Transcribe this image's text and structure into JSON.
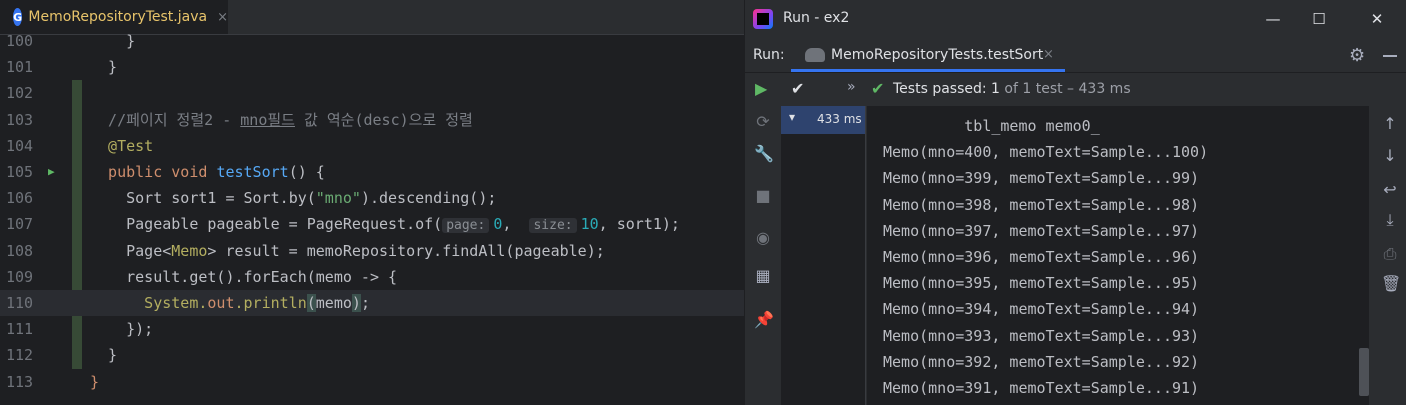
{
  "editor": {
    "tab": {
      "icon_letter": "G",
      "filename": "MemoRepositoryTest.java",
      "close": "×"
    },
    "lines": [
      {
        "num": "100",
        "code": [
          {
            "c": "ty",
            "t": "    }"
          }
        ]
      },
      {
        "num": "101",
        "code": [
          {
            "c": "ty",
            "t": "  }"
          }
        ]
      },
      {
        "num": "102",
        "code": []
      },
      {
        "num": "103",
        "code": [
          {
            "c": "cm",
            "t": "  //페이지 정렬2 - "
          },
          {
            "c": "cm u",
            "t": "mno필드"
          },
          {
            "c": "cm",
            "t": " 값 역순(desc)으로 정렬"
          }
        ]
      },
      {
        "num": "104",
        "code": [
          {
            "c": "an",
            "t": "  @Test"
          }
        ]
      },
      {
        "num": "105",
        "code": [
          {
            "c": "kw",
            "t": "  public void "
          },
          {
            "c": "fn",
            "t": "testSort"
          },
          {
            "c": "ty",
            "t": "() {"
          }
        ]
      },
      {
        "num": "106",
        "code": [
          {
            "c": "ty",
            "t": "    Sort sort1 = Sort."
          },
          {
            "c": "ty",
            "t": "by("
          },
          {
            "c": "st",
            "t": "\"mno\""
          },
          {
            "c": "ty",
            "t": ").descending();"
          }
        ]
      },
      {
        "num": "107",
        "code": [
          {
            "c": "ty",
            "t": "    Pageable pageable = PageRequest."
          },
          {
            "c": "ty",
            "t": "of("
          },
          {
            "c": "hint",
            "t": "page:"
          },
          {
            "c": "nm",
            "t": "0"
          },
          {
            "c": "ty",
            "t": ",  "
          },
          {
            "c": "hint",
            "t": "size:"
          },
          {
            "c": "nm",
            "t": "10"
          },
          {
            "c": "ty",
            "t": ", sort1);"
          }
        ]
      },
      {
        "num": "108",
        "code": [
          {
            "c": "ty",
            "t": "    Page<"
          },
          {
            "c": "an",
            "t": "Memo"
          },
          {
            "c": "ty",
            "t": "> result = memoRepository.findAll(pageable);"
          }
        ]
      },
      {
        "num": "109",
        "code": [
          {
            "c": "ty",
            "t": "    result.get().forEach(memo -> {"
          }
        ]
      },
      {
        "num": "110",
        "code": [
          {
            "c": "an",
            "t": "      System."
          },
          {
            "c": "kw",
            "t": "out"
          },
          {
            "c": "an",
            "t": ".println"
          },
          {
            "c": "bh",
            "t": "("
          },
          {
            "c": "ty",
            "t": "memo"
          },
          {
            "c": "bh",
            "t": ")"
          },
          {
            "c": "ty",
            "t": ";"
          }
        ]
      },
      {
        "num": "111",
        "code": [
          {
            "c": "ty",
            "t": "    });"
          }
        ]
      },
      {
        "num": "112",
        "code": [
          {
            "c": "ty",
            "t": "  }"
          }
        ]
      },
      {
        "num": "113",
        "code": [
          {
            "c": "kw",
            "t": "}"
          }
        ]
      }
    ]
  },
  "run_window": {
    "title": "Run - ex2",
    "minimize": "—",
    "maximize": "☐",
    "close": "✕",
    "run_label": "Run:",
    "tab_label": "MemoRepositoryTests.testSort",
    "tab_close": "×",
    "toolbar": {
      "rerun_icon": "▶",
      "check_icon": "✔",
      "more_icon": "»",
      "passed_icon": "✔",
      "passed_text": "Tests passed:",
      "passed_count": "1",
      "passed_rest": "of 1 test – 433 ms"
    },
    "tree": {
      "chevron": "▾",
      "time": "433 ms"
    },
    "console_lines": [
      "         tbl_memo memo0_",
      "Memo(mno=400, memoText=Sample...100)",
      "Memo(mno=399, memoText=Sample...99)",
      "Memo(mno=398, memoText=Sample...98)",
      "Memo(mno=397, memoText=Sample...97)",
      "Memo(mno=396, memoText=Sample...96)",
      "Memo(mno=395, memoText=Sample...95)",
      "Memo(mno=394, memoText=Sample...94)",
      "Memo(mno=393, memoText=Sample...93)",
      "Memo(mno=392, memoText=Sample...92)",
      "Memo(mno=391, memoText=Sample...91)"
    ]
  },
  "colors": {
    "editor_bg": "#1e1f22",
    "panel_bg": "#2b2d30",
    "accent": "#3574f0",
    "pass_green": "#5fb865",
    "keyword": "#cf8e6d",
    "annotation": "#b3ae60"
  }
}
